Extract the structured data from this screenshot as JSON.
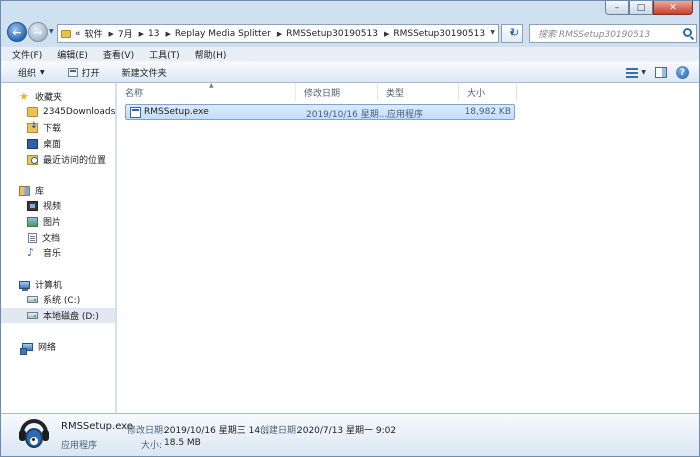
{
  "window": {
    "controls": {
      "minimize": "–",
      "maximize": "□",
      "close": "✕"
    }
  },
  "nav": {
    "back_glyph": "←",
    "forward_glyph": "→",
    "address": {
      "overflow": "«",
      "segments": [
        "软件",
        "7月",
        "13",
        "Replay Media Splitter",
        "RMSSetup30190513",
        "RMSSetup30190513"
      ],
      "separator": "▶"
    },
    "refresh_glyph": "↻",
    "search_placeholder": "搜索 RMSSetup30190513"
  },
  "menu": {
    "items": [
      "文件(F)",
      "编辑(E)",
      "查看(V)",
      "工具(T)",
      "帮助(H)"
    ]
  },
  "toolbar": {
    "organize": "组织",
    "open": "打开",
    "new_folder": "新建文件夹",
    "help_glyph": "?"
  },
  "sidebar": {
    "favorites": {
      "title": "收藏夹",
      "items": [
        "2345Downloads",
        "下载",
        "桌面",
        "最近访问的位置"
      ]
    },
    "libraries": {
      "title": "库",
      "items": [
        "视频",
        "图片",
        "文档",
        "音乐"
      ]
    },
    "computer": {
      "title": "计算机",
      "items": [
        "系统 (C:)",
        "本地磁盘 (D:)"
      ]
    },
    "network": {
      "title": "网络"
    }
  },
  "columns": [
    "名称",
    "修改日期",
    "类型",
    "大小"
  ],
  "files": [
    {
      "name": "RMSSetup.exe",
      "modified": "2019/10/16 星期...",
      "type": "应用程序",
      "size": "18,982 KB"
    }
  ],
  "details": {
    "name": "RMSSetup.exe",
    "type": "应用程序",
    "modified_label": "修改日期:",
    "modified": "2019/10/16 星期三 14...",
    "created_label": "创建日期:",
    "created": "2020/7/13 星期一 9:02",
    "size_label": "大小:",
    "size": "18.5 MB"
  },
  "colors": {
    "accent": "#2d6cb0",
    "selection": "#c1dcfc",
    "chrome": "#cfe0f1"
  }
}
